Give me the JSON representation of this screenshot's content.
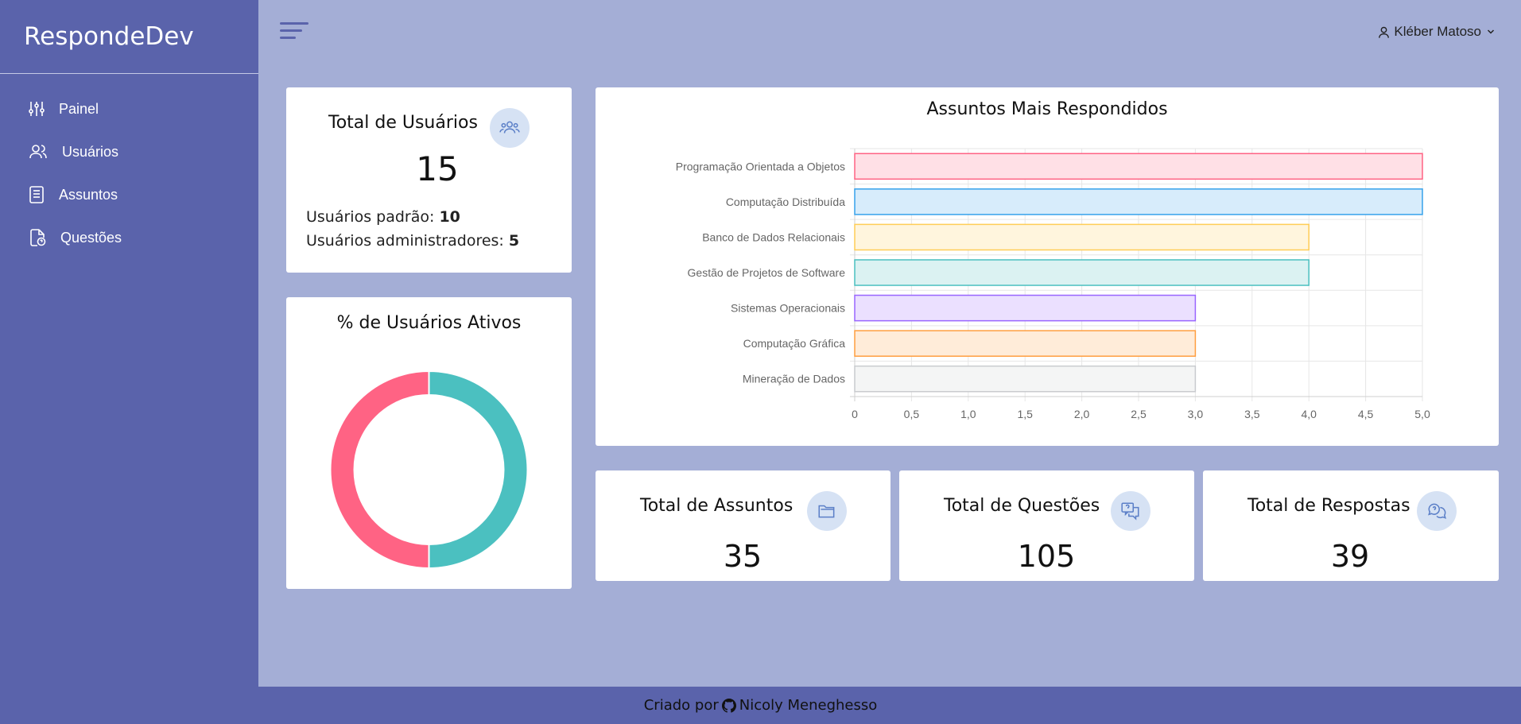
{
  "brand": "RespondeDev",
  "sidebar": {
    "items": [
      {
        "label": "Painel",
        "icon": "sliders-icon"
      },
      {
        "label": "Usuários",
        "icon": "users-icon"
      },
      {
        "label": "Assuntos",
        "icon": "document-icon"
      },
      {
        "label": "Questões",
        "icon": "file-question-icon"
      }
    ]
  },
  "header": {
    "user_name": "Kléber Matoso"
  },
  "users_card": {
    "title": "Total de Usuários",
    "total": "15",
    "standard_label": "Usuários padrão:",
    "standard_value": "10",
    "admin_label": "Usuários administradores:",
    "admin_value": "5"
  },
  "active_card": {
    "title": "% de Usuários Ativos"
  },
  "stats": {
    "subjects": {
      "title": "Total de Assuntos",
      "value": "35"
    },
    "questions": {
      "title": "Total de Questões",
      "value": "105"
    },
    "answers": {
      "title": "Total de Respostas",
      "value": "39"
    }
  },
  "footer": {
    "prefix": "Criado por",
    "author": "Nicoly Meneghesso"
  },
  "colors": {
    "sidebar": "#5a63ab",
    "background": "#a4aed6",
    "donut_red": "#ff6384",
    "donut_teal": "#4bc0c0"
  },
  "chart_data": [
    {
      "type": "bar",
      "orientation": "horizontal",
      "title": "Assuntos Mais Respondidos",
      "categories": [
        "Programação Orientada a Objetos",
        "Computação Distribuída",
        "Banco de Dados Relacionais",
        "Gestão de Projetos de Software",
        "Sistemas Operacionais",
        "Computação Gráfica",
        "Mineração de Dados"
      ],
      "values": [
        5,
        5,
        4,
        4,
        3,
        3,
        3
      ],
      "xlim": [
        0,
        5
      ],
      "ticks": [
        "0",
        "0,5",
        "1,0",
        "1,5",
        "2,0",
        "2,5",
        "3,0",
        "3,5",
        "4,0",
        "4,5",
        "5,0"
      ],
      "fills": [
        "#ffe0e6",
        "#d7ecfb",
        "#fff5dd",
        "#dbf2f2",
        "#ebe0ff",
        "#ffecd9",
        "#f4f5f5"
      ],
      "strokes": [
        "#ff6384",
        "#36a2eb",
        "#ffcd56",
        "#4bc0c0",
        "#9966ff",
        "#ff9f40",
        "#c9cbcf"
      ],
      "grid": true
    },
    {
      "type": "pie",
      "variant": "donut",
      "values": [
        50,
        50
      ],
      "colors": [
        "#4bc0c0",
        "#ff6384"
      ]
    }
  ]
}
